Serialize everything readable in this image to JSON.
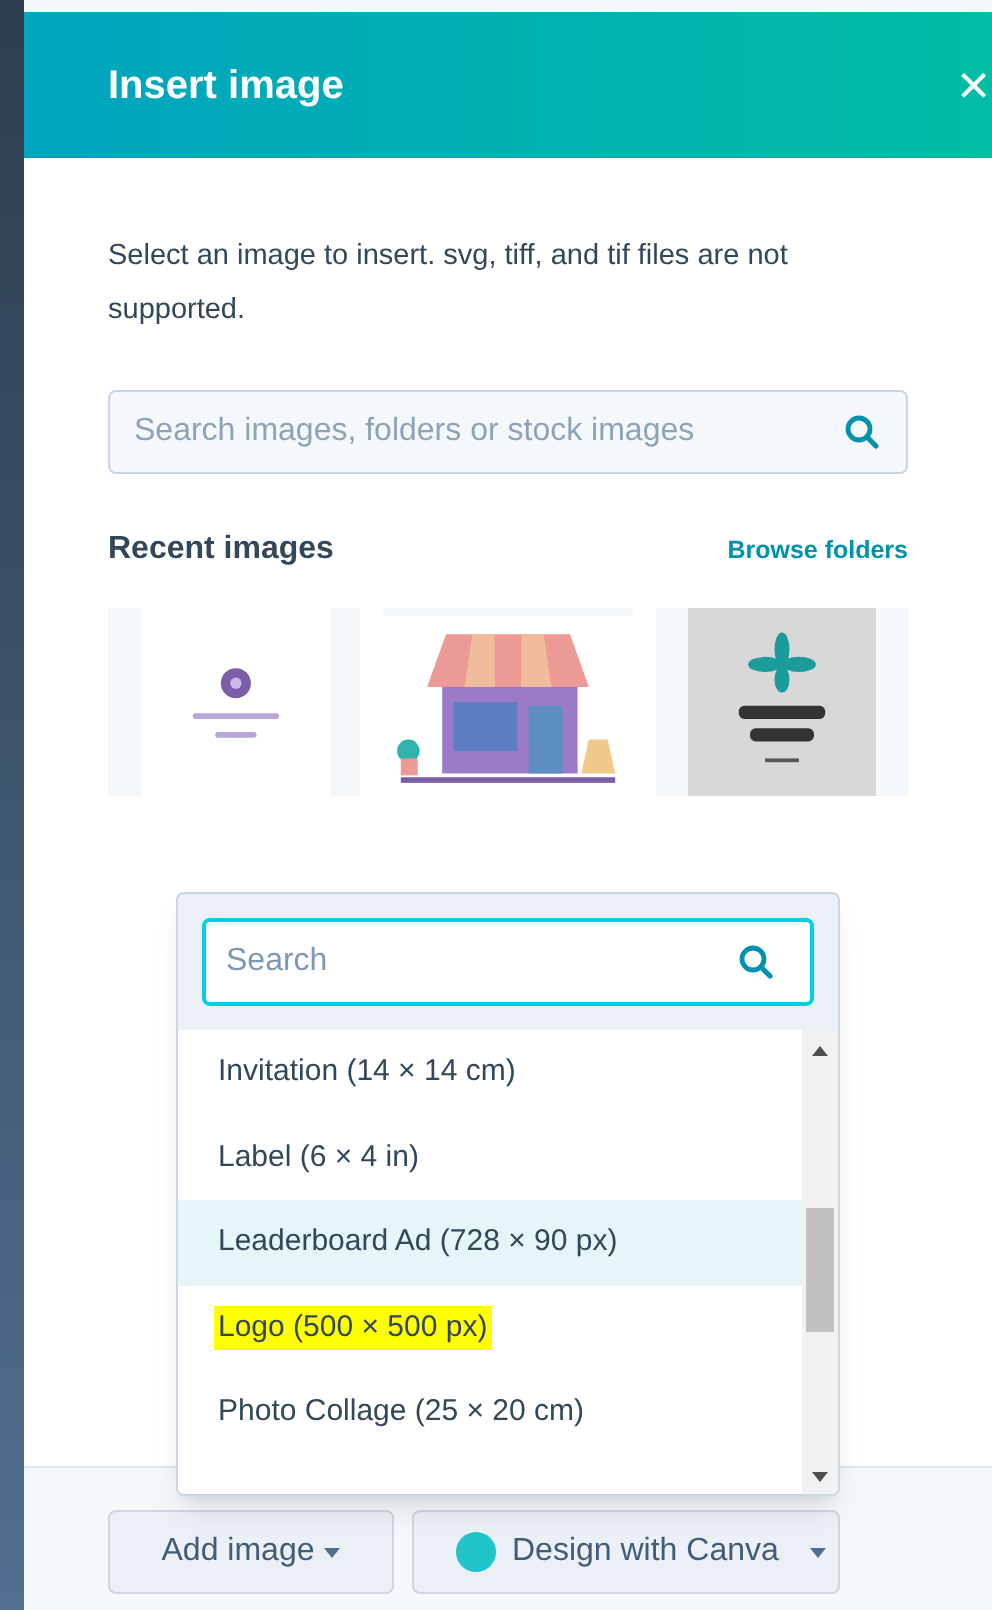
{
  "dialog": {
    "title": "Insert image",
    "close": "×"
  },
  "description": "Select an image to insert. svg, tiff, and tif files are not supported.",
  "search": {
    "placeholder": "Search images, folders or stock images"
  },
  "recent": {
    "heading": "Recent images",
    "link": "Browse folders"
  },
  "dropdown": {
    "search": {
      "placeholder": "Search"
    },
    "items": [
      {
        "label": "Invitation (14 × 14 cm)",
        "selected": false,
        "highlighted": false
      },
      {
        "label": "Label (6 × 4 in)",
        "selected": false,
        "highlighted": false
      },
      {
        "label": "Leaderboard Ad (728 × 90 px)",
        "selected": true,
        "highlighted": false
      },
      {
        "label": "Logo (500 × 500 px)",
        "selected": false,
        "highlighted": true
      },
      {
        "label": "Photo Collage (25 × 20 cm)",
        "selected": false,
        "highlighted": false
      }
    ]
  },
  "footer": {
    "buttons": [
      {
        "label": "Add image",
        "kind": "plain"
      },
      {
        "label": "Design with Canva",
        "kind": "canva"
      }
    ]
  }
}
